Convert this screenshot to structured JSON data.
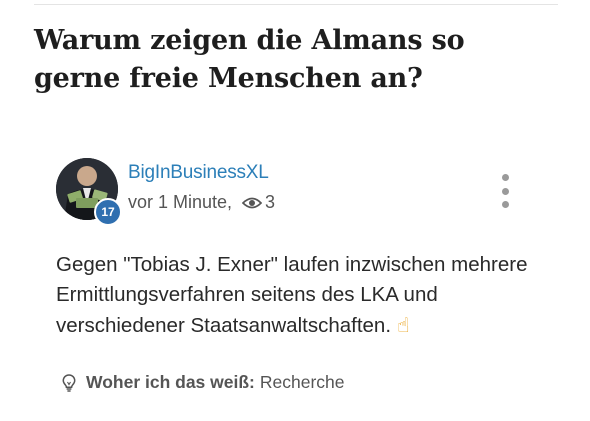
{
  "question": {
    "title": "Warum zeigen die Almans so gerne freie Menschen an?"
  },
  "answer": {
    "author": "BigInBusinessXL",
    "level_badge": "17",
    "time": "vor 1 Minute,",
    "views": "3",
    "body": "Gegen \"Tobias J. Exner\" laufen inzwischen mehrere Ermittlungsverfahren seitens des LKA und verschiedener Staatsanwaltschaften.",
    "emoji": "☝",
    "source_label": "Woher ich das weiß:",
    "source_value": "Recherche"
  },
  "icons": {
    "views": "eye-icon",
    "menu": "more-vertical-icon",
    "source": "lightbulb-icon"
  },
  "colors": {
    "username": "#2c7fb8",
    "badge": "#2f6fb0",
    "emoji": "#e9a21b"
  }
}
